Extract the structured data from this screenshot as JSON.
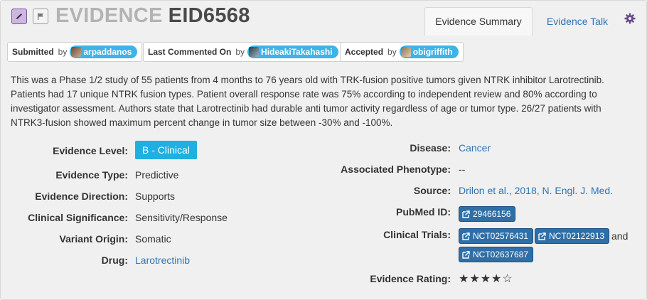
{
  "header": {
    "label": "EVIDENCE",
    "id": "EID6568",
    "tabs": [
      {
        "label": "Evidence Summary",
        "active": true
      },
      {
        "label": "Evidence Talk",
        "active": false
      }
    ],
    "accent": "#7a5a9a"
  },
  "attributions": {
    "submitted": {
      "key": "Submitted",
      "by": "by",
      "user": "arpaddanos"
    },
    "commented": {
      "key": "Last Commented On",
      "by": "by",
      "user": "HideakiTakahashi"
    },
    "accepted": {
      "key": "Accepted",
      "by": "by",
      "user": "obigriffith"
    }
  },
  "description": "This was a Phase 1/2 study of 55 patients from 4 months to 76 years old with TRK-fusion positive tumors given NTRK inhibitor Larotrectinib. Patients had 17 unique NTRK fusion types. Patient overall response rate was 75% according to independent review and 80% according to investigator assessment. Authors state that Larotrectinib had durable anti tumor activity regardless of age or tumor type. 26/27 patients with NTRK3-fusion showed maximum percent change in tumor size between -30% and -100%.",
  "left_fields": {
    "level": {
      "label": "Evidence Level:",
      "value": "B - Clinical"
    },
    "type": {
      "label": "Evidence Type:",
      "value": "Predictive"
    },
    "direction": {
      "label": "Evidence Direction:",
      "value": "Supports"
    },
    "significance": {
      "label": "Clinical Significance:",
      "value": "Sensitivity/Response"
    },
    "origin": {
      "label": "Variant Origin:",
      "value": "Somatic"
    },
    "drug": {
      "label": "Drug:",
      "value": "Larotrectinib"
    }
  },
  "right_fields": {
    "disease": {
      "label": "Disease:",
      "value": "Cancer"
    },
    "phenotype": {
      "label": "Associated Phenotype:",
      "value": "--"
    },
    "source": {
      "label": "Source:",
      "value": "Drilon et al., 2018, N. Engl. J. Med."
    },
    "pubmed": {
      "label": "PubMed ID:",
      "value": "29466156"
    },
    "trials": {
      "label": "Clinical Trials:",
      "items": [
        "NCT02576431",
        "NCT02122913",
        "NCT02637687"
      ],
      "joiner": "and"
    },
    "rating": {
      "label": "Evidence Rating:",
      "value": 4,
      "max": 5,
      "display": "★★★★☆"
    }
  }
}
